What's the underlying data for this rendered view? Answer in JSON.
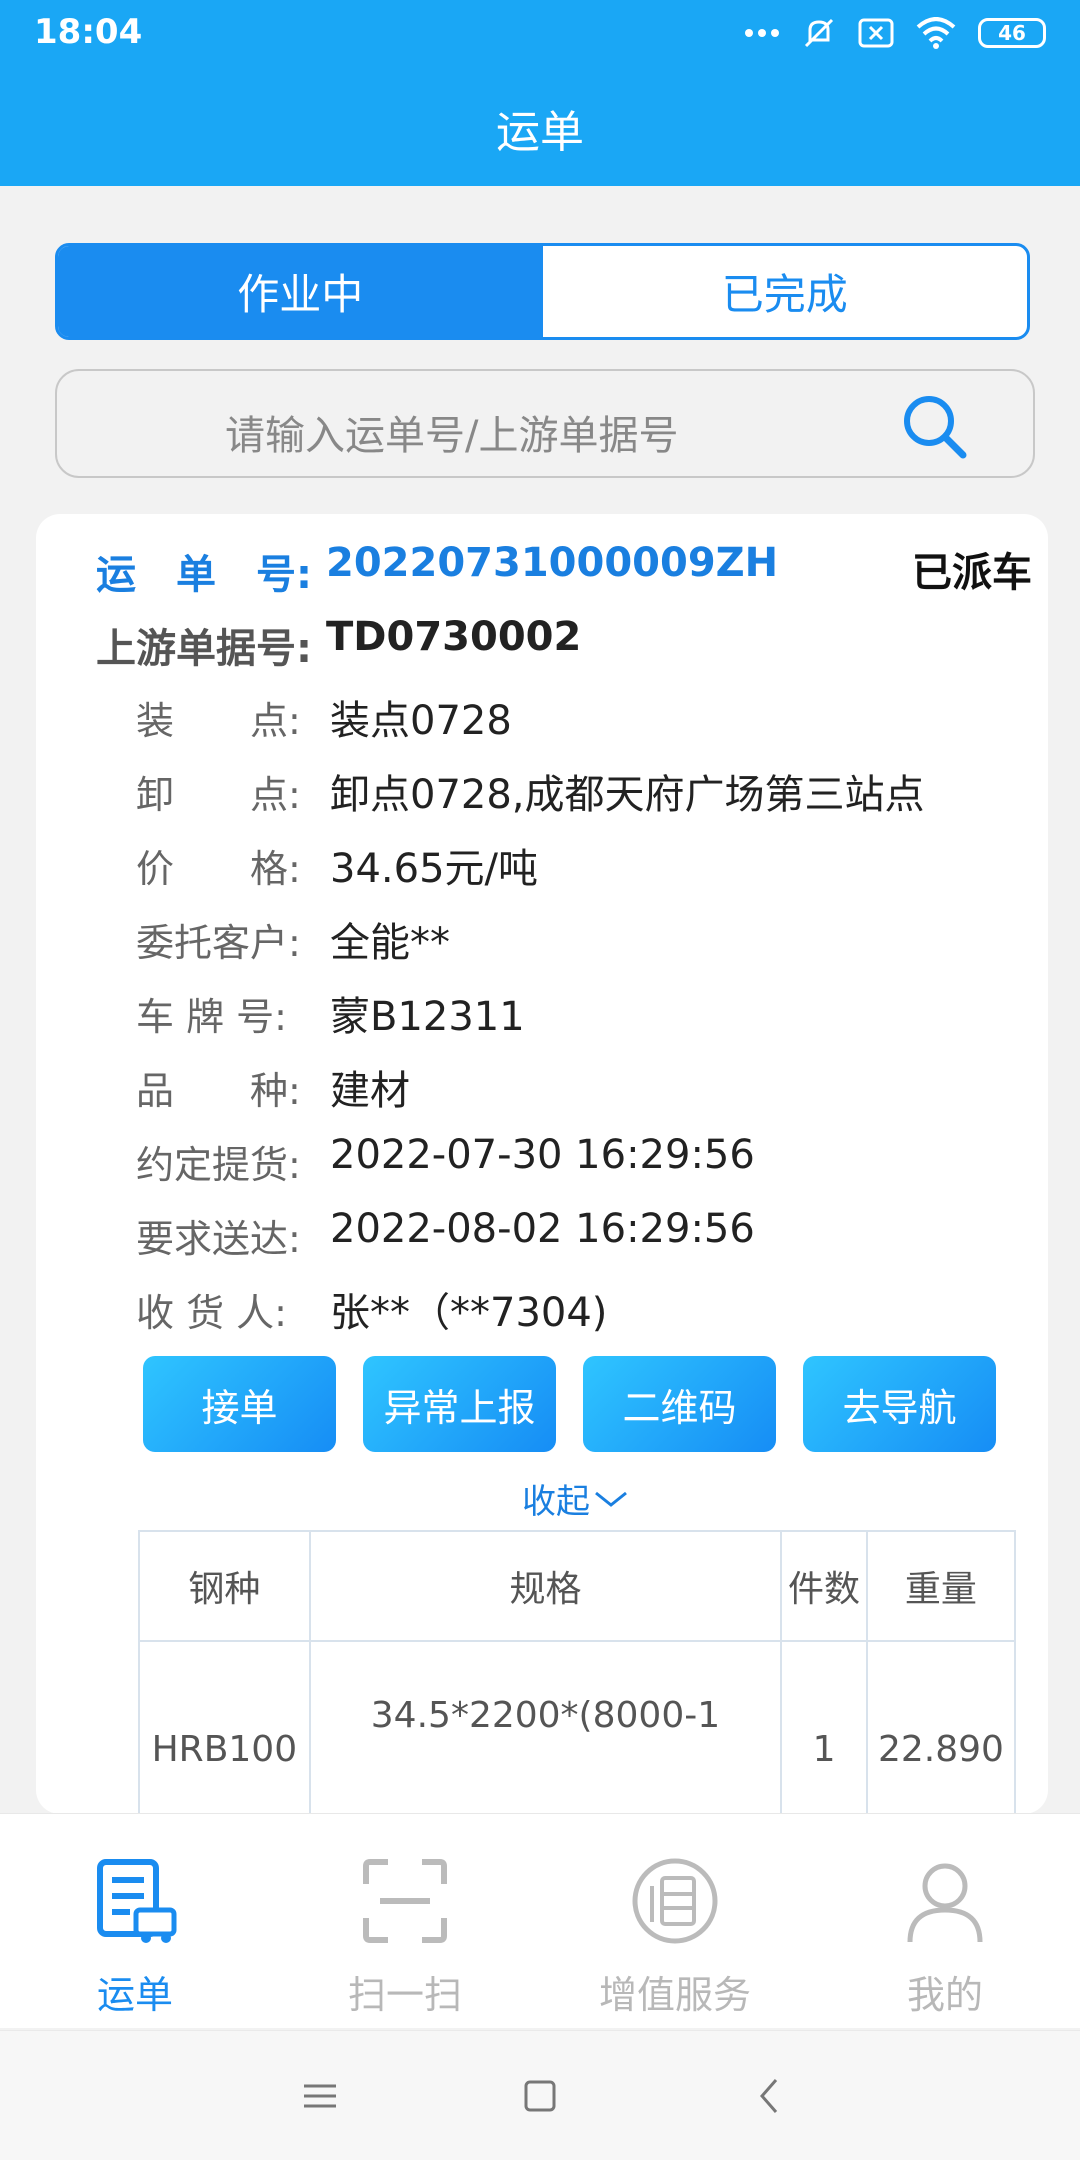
{
  "status_bar": {
    "time": "18:04",
    "battery": "46"
  },
  "header": {
    "title": "运单"
  },
  "segments": {
    "active": "作业中",
    "inactive": "已完成"
  },
  "search": {
    "placeholder": "请输入运单号/上游单据号"
  },
  "card": {
    "status": "已派车",
    "waybill_label": "运　单　号:",
    "waybill_no": "20220731000009ZH",
    "upstream_label": "上游单据号:",
    "upstream_no": "TD0730002",
    "fields": [
      {
        "label": "装　　点:",
        "value": "装点0728"
      },
      {
        "label": "卸　　点:",
        "value": "卸点0728,成都天府广场第三站点"
      },
      {
        "label": "价　　格:",
        "value": "34.65元/吨"
      },
      {
        "label": "委托客户:",
        "value": "全能**"
      },
      {
        "label": "车 牌 号:",
        "value": "蒙B12311"
      },
      {
        "label": "品　　种:",
        "value": "建材"
      },
      {
        "label": "约定提货:",
        "value": "2022-07-30 16:29:56"
      },
      {
        "label": "要求送达:",
        "value": "2022-08-02 16:29:56"
      },
      {
        "label": "收 货 人:",
        "value": "张**（**7304)"
      }
    ],
    "buttons": [
      "接单",
      "异常上报",
      "二维码",
      "去导航"
    ],
    "collapse": "收起",
    "table": {
      "headers": [
        "钢种",
        "规格",
        "件数",
        "重量"
      ],
      "row": [
        "HRB100",
        "34.5*2200*(8000-1",
        "1",
        "22.890"
      ]
    }
  },
  "tabbar": {
    "items": [
      {
        "label": "运单",
        "icon": "waybill-icon",
        "active": true
      },
      {
        "label": "扫一扫",
        "icon": "scan-icon",
        "active": false
      },
      {
        "label": "增值服务",
        "icon": "value-added-icon",
        "active": false
      },
      {
        "label": "我的",
        "icon": "profile-icon",
        "active": false
      }
    ]
  },
  "colors": {
    "primary": "#1a8cf0",
    "header": "#1aa7f5"
  }
}
